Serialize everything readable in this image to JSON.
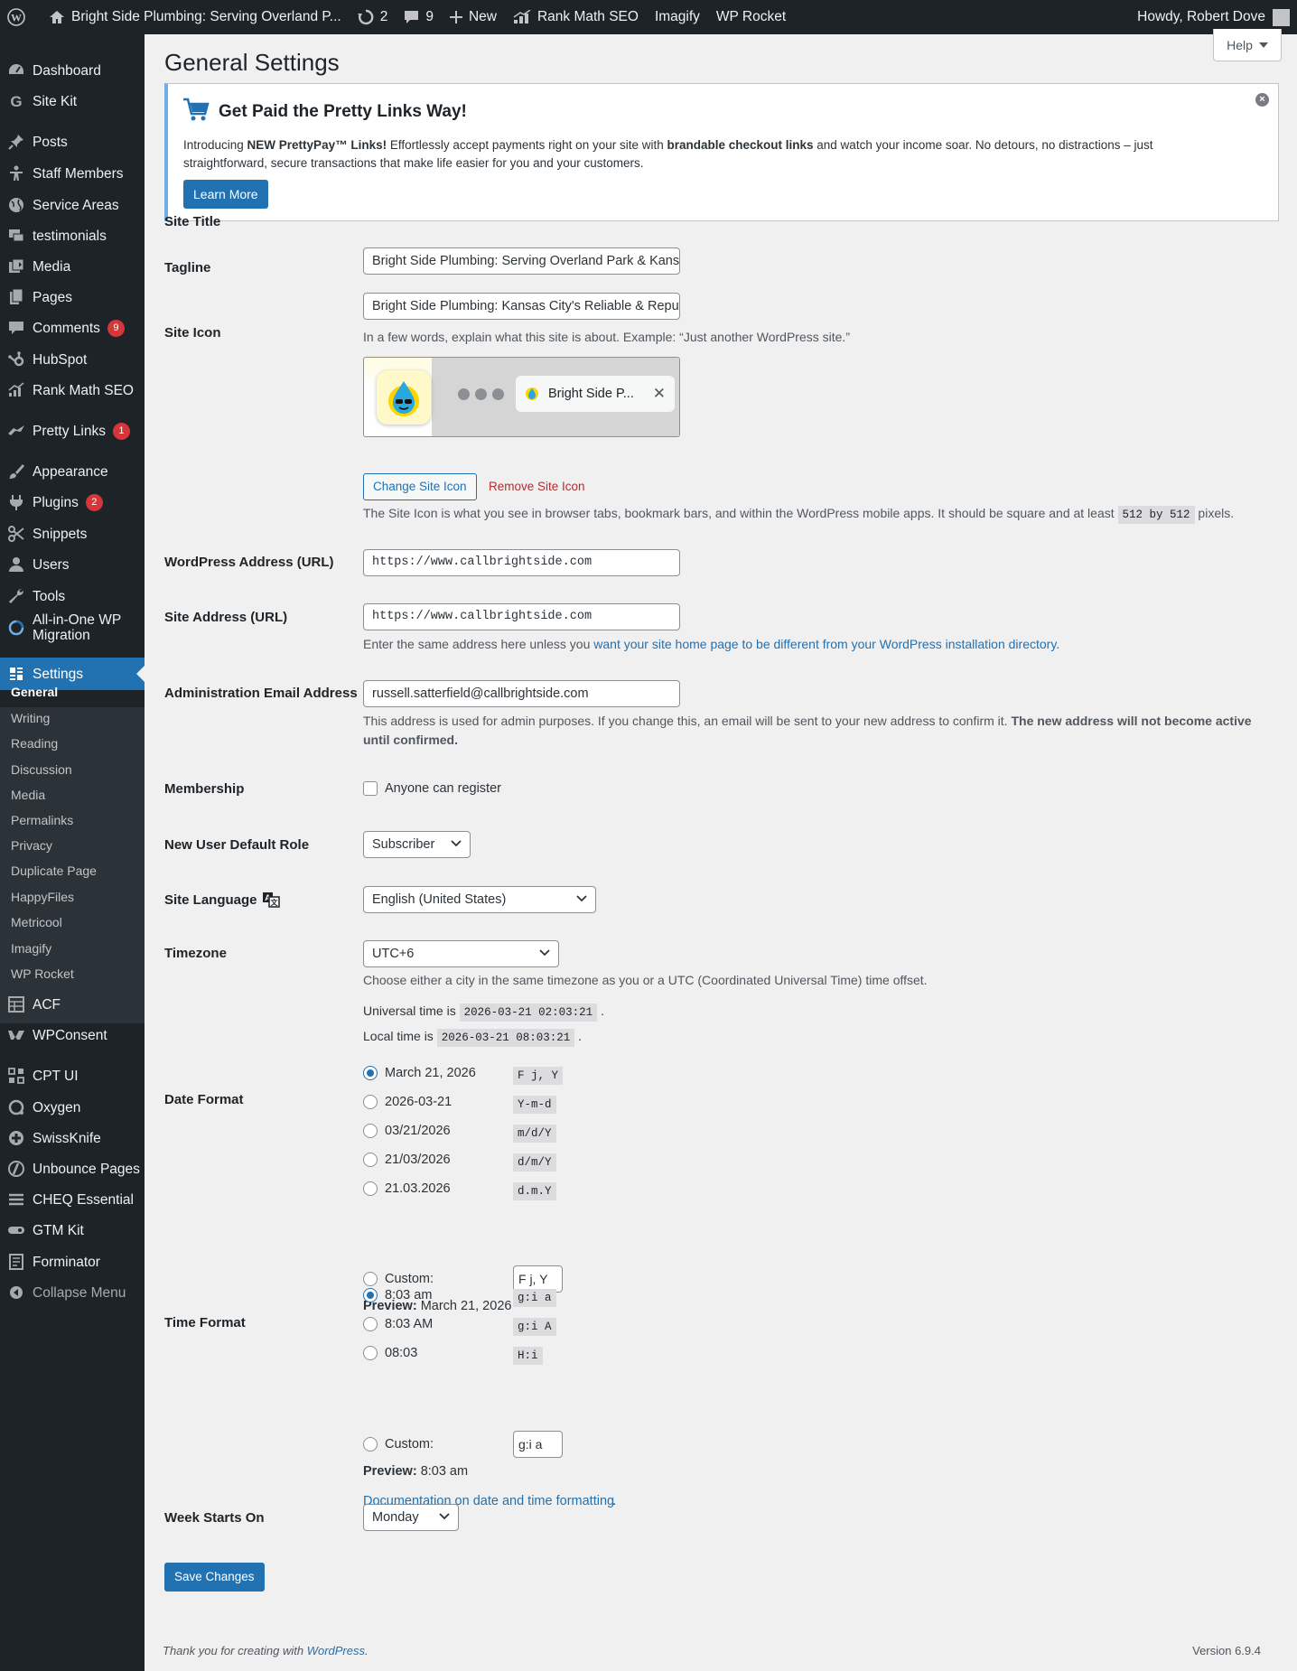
{
  "adminbar": {
    "site_name": "Bright Side Plumbing: Serving Overland P...",
    "updates_count": "2",
    "comments_count": "9",
    "new_label": "New",
    "rank_math": "Rank Math SEO",
    "imagify": "Imagify",
    "wp_rocket": "WP Rocket",
    "howdy": "Howdy, Robert Dove"
  },
  "sidebar": {
    "items": [
      {
        "label": "Dashboard",
        "icon": "dashboard-icon"
      },
      {
        "label": "Site Kit",
        "icon": "sitekit-icon"
      },
      {
        "label": "Posts",
        "icon": "pin-icon"
      },
      {
        "label": "Staff Members",
        "icon": "staff-icon"
      },
      {
        "label": "Service Areas",
        "icon": "globe-icon"
      },
      {
        "label": "testimonials",
        "icon": "testimonial-icon"
      },
      {
        "label": "Media",
        "icon": "media-icon"
      },
      {
        "label": "Pages",
        "icon": "pages-icon"
      },
      {
        "label": "Comments",
        "icon": "comment-icon",
        "badge": "9"
      },
      {
        "label": "HubSpot",
        "icon": "hubspot-icon"
      },
      {
        "label": "Rank Math SEO",
        "icon": "rankmath-icon"
      },
      {
        "label": "Pretty Links",
        "icon": "prettylinks-icon",
        "badge": "1"
      },
      {
        "label": "Appearance",
        "icon": "brush-icon"
      },
      {
        "label": "Plugins",
        "icon": "plugin-icon",
        "badge": "2"
      },
      {
        "label": "Snippets",
        "icon": "snippets-icon"
      },
      {
        "label": "Users",
        "icon": "user-icon"
      },
      {
        "label": "Tools",
        "icon": "wrench-icon"
      },
      {
        "label": "All-in-One WP Migration",
        "icon": "migration-icon"
      },
      {
        "label": "Settings",
        "icon": "settings-icon"
      }
    ],
    "submenu": [
      "General",
      "Writing",
      "Reading",
      "Discussion",
      "Media",
      "Permalinks",
      "Privacy",
      "Duplicate Page",
      "HappyFiles",
      "Metricool",
      "Imagify",
      "WP Rocket"
    ],
    "items2": [
      {
        "label": "ACF",
        "icon": "acf-icon"
      },
      {
        "label": "WPConsent",
        "icon": "wpconsent-icon"
      },
      {
        "label": "CPT UI",
        "icon": "cptui-icon"
      },
      {
        "label": "Oxygen",
        "icon": "oxygen-icon"
      },
      {
        "label": "SwissKnife",
        "icon": "swissknife-icon"
      },
      {
        "label": "Unbounce Pages",
        "icon": "unbounce-icon"
      },
      {
        "label": "CHEQ Essential",
        "icon": "cheq-icon"
      },
      {
        "label": "GTM Kit",
        "icon": "gtm-icon"
      },
      {
        "label": "Forminator",
        "icon": "forminator-icon"
      }
    ],
    "collapse": "Collapse Menu"
  },
  "page": {
    "title": "General Settings",
    "help": "Help"
  },
  "notice": {
    "title": "Get Paid the Pretty Links Way!",
    "body_pre": "Introducing ",
    "body_bold1": "NEW PrettyPay™ Links!",
    "body_mid": " Effortlessly accept payments right on your site with ",
    "body_bold2": "brandable checkout links",
    "body_post": " and watch your income soar. No detours, no distractions – just straightforward, secure transactions that make life easier for you and your customers.",
    "button": "Learn More"
  },
  "fields": {
    "site_title_label": "Site Title",
    "site_title": "Bright Side Plumbing: Serving Overland Park & Kansas",
    "tagline_label": "Tagline",
    "tagline": "Bright Side Plumbing: Kansas City's Reliable & Reputal",
    "tagline_desc": "In a few words, explain what this site is about. Example: “Just another WordPress site.”",
    "site_icon_label": "Site Icon",
    "site_icon_tab": "Bright Side P...",
    "change_icon": "Change Site Icon",
    "remove_icon": "Remove Site Icon",
    "icon_desc_pre": "The Site Icon is what you see in browser tabs, bookmark bars, and within the WordPress mobile apps. It should be square and at least ",
    "icon_desc_code": "512 by 512",
    "icon_desc_post": " pixels.",
    "wp_address_label": "WordPress Address (URL)",
    "wp_address": "https://www.callbrightside.com",
    "site_address_label": "Site Address (URL)",
    "site_address": "https://www.callbrightside.com",
    "site_address_desc_pre": "Enter the same address here unless you ",
    "site_address_desc_link": "want your site home page to be different from your WordPress installation directory",
    "site_address_desc_post": ".",
    "admin_email_label": "Administration Email Address",
    "admin_email": "russell.satterfield@callbrightside.com",
    "admin_email_desc": "This address is used for admin purposes. If you change this, an email will be sent to your new address to confirm it.",
    "admin_email_desc_bold": "The new address will not become active until confirmed.",
    "membership_label": "Membership",
    "membership_checkbox": "Anyone can register",
    "default_role_label": "New User Default Role",
    "default_role": "Subscriber",
    "language_label": "Site Language",
    "language": "English (United States)",
    "timezone_label": "Timezone",
    "timezone": "UTC+6",
    "timezone_desc": "Choose either a city in the same timezone as you or a UTC (Coordinated Universal Time) time offset.",
    "universal_time_label": "Universal time is",
    "universal_time": "2026-03-21 02:03:21",
    "local_time_label": "Local time is",
    "local_time": "2026-03-21 08:03:21",
    "date_format_label": "Date Format",
    "date_formats": [
      {
        "label": "March 21, 2026",
        "code": "F j, Y"
      },
      {
        "label": "2026-03-21",
        "code": "Y-m-d"
      },
      {
        "label": "03/21/2026",
        "code": "m/d/Y"
      },
      {
        "label": "21/03/2026",
        "code": "d/m/Y"
      },
      {
        "label": "21.03.2026",
        "code": "d.m.Y"
      }
    ],
    "custom_label": "Custom:",
    "date_custom": "F j, Y",
    "preview_label": "Preview:",
    "date_preview": "March 21, 2026",
    "time_format_label": "Time Format",
    "time_formats": [
      {
        "label": "8:03 am",
        "code": "g:i a"
      },
      {
        "label": "8:03 AM",
        "code": "g:i A"
      },
      {
        "label": "08:03",
        "code": "H:i"
      }
    ],
    "time_custom": "g:i a",
    "time_preview": "8:03 am",
    "doc_link": "Documentation on date and time formatting",
    "week_starts_label": "Week Starts On",
    "week_starts": "Monday",
    "save": "Save Changes"
  },
  "footer": {
    "thanks_pre": "Thank you for creating with ",
    "thanks_link": "WordPress",
    "thanks_post": ".",
    "version": "Version 6.9.4"
  },
  "colors": {
    "accent": "#2271b1",
    "sidebar": "#1d2327",
    "badge": "#d63638",
    "remove": "#b32d2e"
  }
}
